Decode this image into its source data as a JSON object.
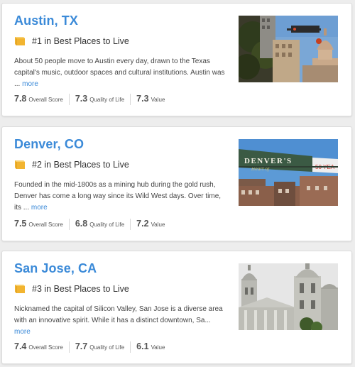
{
  "places": [
    {
      "title": "Austin, TX",
      "rank": "#1 in Best Places to Live",
      "description": "About 50 people move to Austin every day, drawn to the Texas capital's music, outdoor spaces and cultural institutions. Austin was ...",
      "more": "more",
      "scores": [
        {
          "value": "7.8",
          "label": "Overall Score"
        },
        {
          "value": "7.3",
          "label": "Quality of Life"
        },
        {
          "value": "7.3",
          "label": "Value"
        }
      ]
    },
    {
      "title": "Denver, CO",
      "rank": "#2 in Best Places to Live",
      "description": "Founded in the mid-1800s as a mining hub during the gold rush, Denver has come a long way since its Wild West days. Over time, its ...",
      "more": "more",
      "sign_text": "DENVER'S",
      "sign_script": "Heart of",
      "sign_right": "50 YEA",
      "scores": [
        {
          "value": "7.5",
          "label": "Overall Score"
        },
        {
          "value": "6.8",
          "label": "Quality of Life"
        },
        {
          "value": "7.2",
          "label": "Value"
        }
      ]
    },
    {
      "title": "San Jose, CA",
      "rank": "#3 in Best Places to Live",
      "description": "Nicknamed the capital of Silicon Valley, San Jose is a diverse area with an innovative spirit. While it has a distinct downtown, Sa...",
      "more": "more",
      "scores": [
        {
          "value": "7.4",
          "label": "Overall Score"
        },
        {
          "value": "7.7",
          "label": "Quality of Life"
        },
        {
          "value": "6.1",
          "label": "Value"
        }
      ]
    }
  ],
  "icons": {
    "rank_badge": "ribbon-badge-icon"
  },
  "colors": {
    "link": "#3b8ad8",
    "badge": "#f2b430",
    "text": "#333333",
    "background": "#ededed"
  }
}
